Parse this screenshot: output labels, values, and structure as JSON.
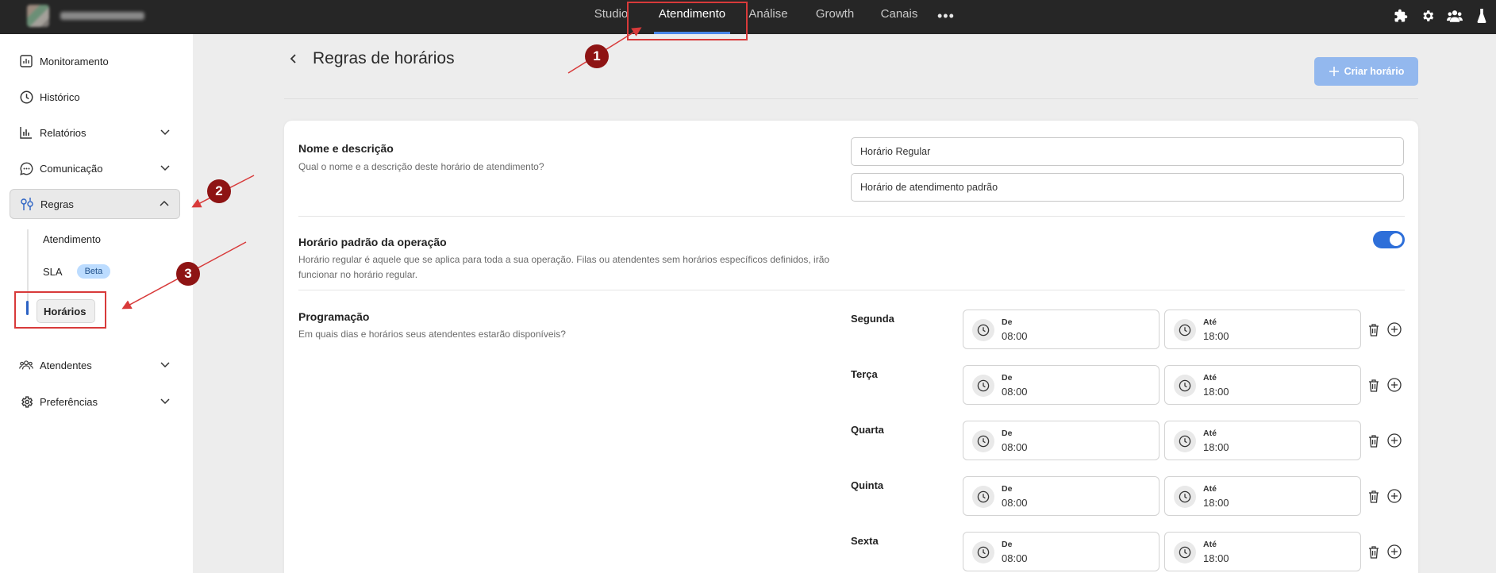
{
  "topnav": {
    "tabs": [
      "Studio",
      "Atendimento",
      "Análise",
      "Growth",
      "Canais"
    ],
    "active_tab": "Atendimento",
    "more_label": "•••",
    "icons": [
      "puzzle-icon",
      "gear-icon",
      "users-icon",
      "flask-icon"
    ]
  },
  "sidebar": {
    "items": [
      {
        "label": "Monitoramento",
        "icon": "dashboard-icon"
      },
      {
        "label": "Histórico",
        "icon": "clock-icon"
      },
      {
        "label": "Relatórios",
        "icon": "bar-chart-icon"
      },
      {
        "label": "Comunicação",
        "icon": "chat-bubble-icon"
      },
      {
        "label": "Regras",
        "icon": "rules-icon"
      },
      {
        "label": "Atendentes",
        "icon": "team-icon"
      },
      {
        "label": "Preferências",
        "icon": "settings-icon"
      }
    ],
    "sub_items": [
      "Atendimento",
      "SLA",
      "Horários"
    ],
    "beta_badge": "Beta"
  },
  "page": {
    "title": "Regras de horários",
    "create_button": "Criar horário"
  },
  "sections": {
    "name": {
      "title": "Nome e descrição",
      "description": "Qual o nome e a descrição deste horário de atendimento?",
      "name_value": "Horário Regular",
      "description_value": "Horário de atendimento padrão"
    },
    "default": {
      "title": "Horário padrão da operação",
      "description": "Horário regular é aquele que se aplica para toda a sua operação. Filas ou atendentes sem horários específicos definidos, irão funcionar no horário regular.",
      "toggle_on": true
    },
    "schedule": {
      "title": "Programação",
      "description": "Em quais dias e horários seus atendentes estarão disponíveis?",
      "from_label": "De",
      "to_label": "Até",
      "days": [
        {
          "day": "Segunda",
          "from": "08:00",
          "to": "18:00"
        },
        {
          "day": "Terça",
          "from": "08:00",
          "to": "18:00"
        },
        {
          "day": "Quarta",
          "from": "08:00",
          "to": "18:00"
        },
        {
          "day": "Quinta",
          "from": "08:00",
          "to": "18:00"
        },
        {
          "day": "Sexta",
          "from": "08:00",
          "to": "18:00"
        }
      ]
    }
  },
  "annotations": {
    "badges": [
      "1",
      "2",
      "3"
    ],
    "color": "#d83a3a"
  }
}
